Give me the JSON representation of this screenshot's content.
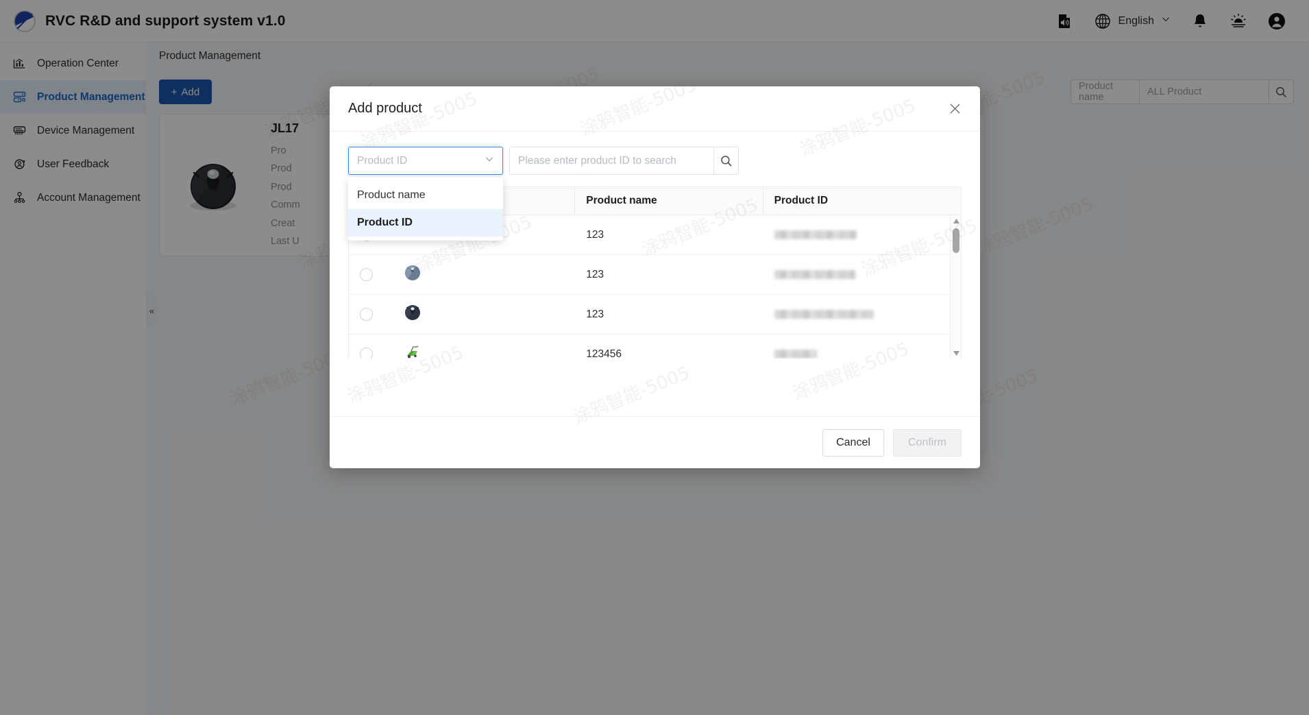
{
  "header": {
    "app_title": "RVC R&D and support system v1.0",
    "logo_icon": "circle-slash-logo",
    "actions": [
      {
        "name": "audio-doc-icon",
        "icon": "document-sound-icon"
      },
      {
        "name": "language-switcher",
        "icon": "globe-icon",
        "label": "English",
        "caret": "chevron-down-icon"
      },
      {
        "name": "notifications",
        "icon": "bell-icon"
      },
      {
        "name": "theme-toggle",
        "icon": "sun-icon"
      },
      {
        "name": "user-account",
        "icon": "user-avatar-icon"
      }
    ]
  },
  "sidebar": {
    "collapse_label": "«",
    "items": [
      {
        "label": "Operation Center",
        "icon": "chart-stats-icon",
        "active": false
      },
      {
        "label": "Product Management",
        "icon": "server-product-icon",
        "active": true
      },
      {
        "label": "Device Management",
        "icon": "device-hardware-icon",
        "active": false
      },
      {
        "label": "User Feedback",
        "icon": "user-feedback-icon",
        "active": false
      },
      {
        "label": "Account Management",
        "icon": "account-hierarchy-icon",
        "active": false
      }
    ]
  },
  "main": {
    "breadcrumb": "Product Management",
    "add_button": "Add",
    "add_icon": "plus-icon",
    "filter_select_value": "Product name",
    "filter_search_value": "ALL Product",
    "search_icon": "search-icon",
    "product_card": {
      "name": "JL17",
      "thumb_icon": "robot-vacuum-icon",
      "fields": [
        "Pro",
        "Prod",
        "Prod",
        "Comm",
        "Creat",
        "Last U"
      ]
    }
  },
  "modal": {
    "title": "Add product",
    "close_icon": "close-icon",
    "search_type": {
      "placeholder": "Product ID",
      "caret_icon": "chevron-down-icon",
      "options": [
        {
          "label": "Product name",
          "selected": false
        },
        {
          "label": "Product ID",
          "selected": true
        }
      ]
    },
    "search": {
      "placeholder": "Please enter product ID to search",
      "value": "",
      "button_icon": "search-icon"
    },
    "table": {
      "columns": [
        "",
        "",
        "Product name",
        "Product ID"
      ],
      "rows": [
        {
          "selected": false,
          "thumb": "robot-vacuum-blue-icon",
          "name": "123",
          "product_id": ""
        },
        {
          "selected": false,
          "thumb": "robot-vacuum-grey-icon",
          "name": "123",
          "product_id": ""
        },
        {
          "selected": false,
          "thumb": "robot-vacuum-dark-icon",
          "name": "123",
          "product_id": ""
        },
        {
          "selected": false,
          "thumb": "lawn-mower-green-icon",
          "name": "123456",
          "product_id": ""
        }
      ]
    },
    "scrollbar": {
      "up_icon": "triangle-up-icon",
      "down_icon": "triangle-down-icon"
    },
    "footer": {
      "cancel": "Cancel",
      "confirm": "Confirm",
      "confirm_disabled": true
    }
  },
  "watermark": {
    "text": "涂鸦智能-5005"
  },
  "colors": {
    "accent": "#1a56b0",
    "active_nav_bg": "#e8f1fd",
    "active_nav_text": "#1a66c9",
    "focus_border": "#3f8ae0",
    "option_selected_bg": "#e9f3fd",
    "page_bg": "#f5f6f8"
  }
}
